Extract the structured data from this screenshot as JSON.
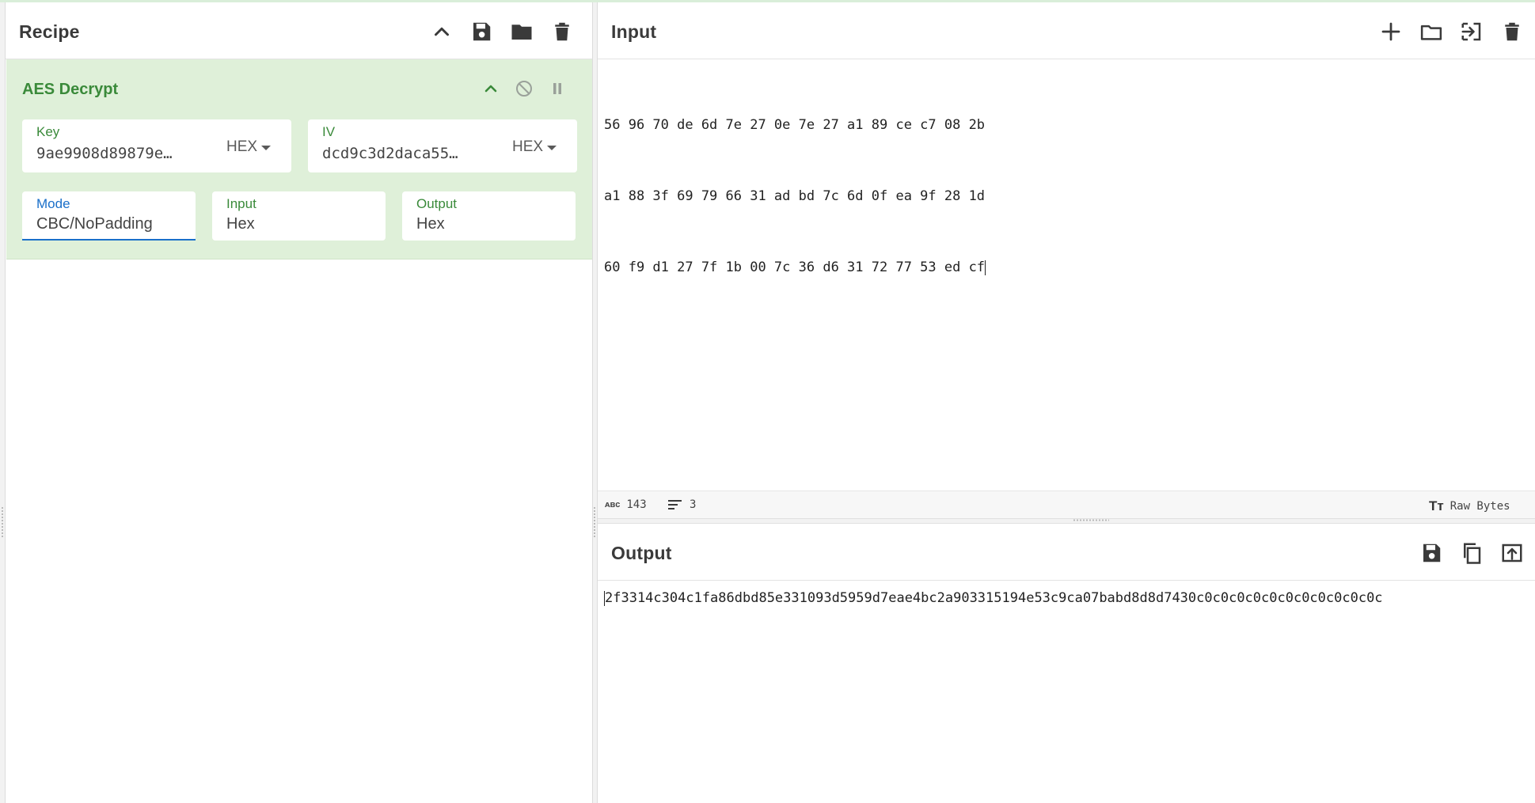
{
  "recipe": {
    "title": "Recipe",
    "icons": [
      "collapse-all-icon",
      "save-icon",
      "load-icon",
      "trash-icon"
    ]
  },
  "operation": {
    "name": "AES Decrypt",
    "key": {
      "label": "Key",
      "value": "9ae9908d89879e…",
      "format": "HEX"
    },
    "iv": {
      "label": "IV",
      "value": "dcd9c3d2daca55…",
      "format": "HEX"
    },
    "mode": {
      "label": "Mode",
      "value": "CBC/NoPadding"
    },
    "input": {
      "label": "Input",
      "value": "Hex"
    },
    "output": {
      "label": "Output",
      "value": "Hex"
    }
  },
  "input": {
    "title": "Input",
    "lines": [
      "56 96 70 de 6d 7e 27 0e 7e 27 a1 89 ce c7 08 2b",
      "a1 88 3f 69 79 66 31 ad bd 7c 6d 0f ea 9f 28 1d",
      "60 f9 d1 27 7f 1b 00 7c 36 d6 31 72 77 53 ed cf"
    ],
    "status": {
      "length": "143",
      "lines": "3",
      "encoding": "Raw Bytes"
    }
  },
  "output": {
    "title": "Output",
    "text": "2f3314c304c1fa86dbd85e331093d5959d7eae4bc2a903315194e53c9ca07babd8d8d7430c0c0c0c0c0c0c0c0c0c0c0c"
  },
  "colors": {
    "operation_bg": "#dff0d9",
    "operation_text": "#3a8a3a",
    "focus_blue": "#1a6fc9"
  }
}
